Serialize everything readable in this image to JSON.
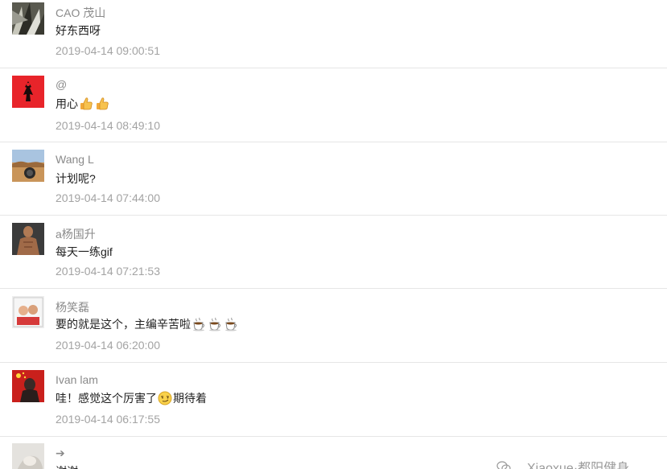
{
  "comments": [
    {
      "user": "CAO 茂山",
      "text": "好东西呀",
      "time": "2019-04-14 09:00:51"
    },
    {
      "user": "@",
      "text": "用心",
      "time": "2019-04-14 08:49:10"
    },
    {
      "user": "Wang L",
      "text": "计划呢?",
      "time": "2019-04-14 07:44:00"
    },
    {
      "user": "a杨国升",
      "text": "每天一练gif",
      "time": "2019-04-14 07:21:53"
    },
    {
      "user": "杨笑磊",
      "text": "要的就是这个，主编辛苦啦",
      "time": "2019-04-14 06:20:00"
    },
    {
      "user": "Ivan lam",
      "text": "哇！感觉这个厉害了",
      "text_after": "期待着",
      "time": "2019-04-14 06:17:55"
    },
    {
      "user": "➔",
      "text": "谢谢"
    }
  ],
  "emojis": {
    "thumbs_up": "thumbs-up-icon",
    "coffee": "coffee-icon",
    "smirk": "smirk-face-icon"
  },
  "watermark": {
    "text": "Xiaoxue·都阳健身"
  },
  "colors": {
    "username": "#8a8a8a",
    "timestamp": "#a3a3a3",
    "text": "#222222",
    "divider": "#e6e6e6"
  }
}
